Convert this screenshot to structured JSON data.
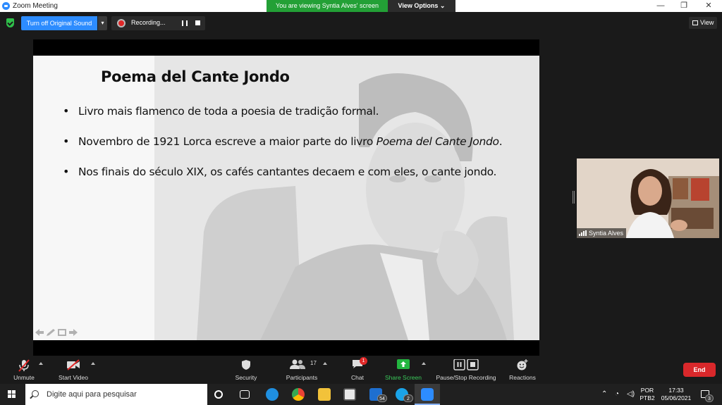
{
  "window": {
    "title": "Zoom Meeting",
    "minimize": "—",
    "restore": "❐",
    "close": "✕"
  },
  "banner": {
    "viewing": "You are viewing Syntia Alves' screen",
    "view_options": "View Options ⌄"
  },
  "top_toolbar": {
    "original_sound": "Turn off Original Sound",
    "original_sound_caret": "▾",
    "recording_label": "Recording...",
    "view_label": "View"
  },
  "slide": {
    "title": "Poema del Cante Jondo",
    "bullet1": "Livro mais flamenco de toda a poesia de tradição formal.",
    "bullet2_prefix": "Novembro de 1921 Lorca escreve a maior parte do livro ",
    "bullet2_italic": "Poema del Cante Jondo",
    "bullet2_suffix": ".",
    "bullet3": "Nos finais do século XIX, os cafés cantantes decaem e com eles, o cante jondo."
  },
  "participant": {
    "name": "Syntia Alves"
  },
  "bottom_toolbar": {
    "unmute": "Unmute",
    "start_video": "Start Video",
    "security": "Security",
    "participants": "Participants",
    "participants_count": "17",
    "chat": "Chat",
    "chat_badge": "1",
    "share_screen": "Share Screen",
    "pause_stop": "Pause/Stop Recording",
    "reactions": "Reactions",
    "end": "End",
    "share_color": "#23b640",
    "end_color": "#d9282b"
  },
  "taskbar": {
    "search_placeholder": "Digite aqui para pesquisar",
    "mail_badge": "54",
    "skype_badge": "2",
    "lang_top": "POR",
    "lang_bottom": "PTB2",
    "time": "17:33",
    "date": "05/06/2021",
    "notif_count": "3"
  }
}
